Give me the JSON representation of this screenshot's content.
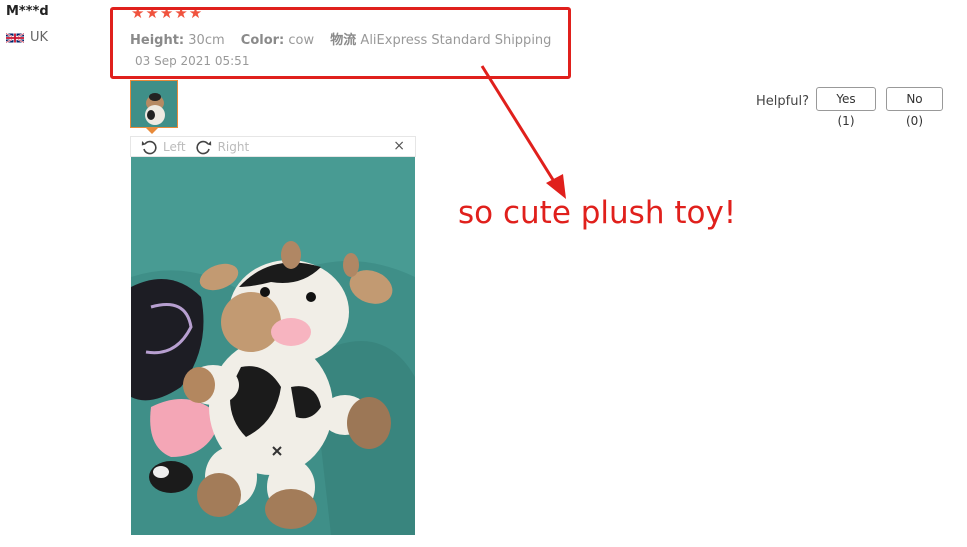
{
  "reviewer": {
    "name": "M***d",
    "country": "UK"
  },
  "review": {
    "rating": 5,
    "stars_text": "★★★★★",
    "height_label": "Height:",
    "height_value": "30cm",
    "color_label": "Color:",
    "color_value": "cow",
    "shipping_label": "物流",
    "shipping_value": "AliExpress Standard Shipping",
    "date": "03 Sep 2021 05:51"
  },
  "helpful": {
    "label": "Helpful?",
    "yes_label": "Yes (1)",
    "no_label": "No (0)"
  },
  "viewer": {
    "left_label": "Left",
    "right_label": "Right",
    "close_label": "×"
  },
  "annotation": {
    "text": "so cute plush toy!"
  },
  "colors": {
    "star": "#f0533e",
    "annotation": "#e0201c",
    "thumb_border": "#e88a3a",
    "photo_background": "#3f8f88"
  }
}
